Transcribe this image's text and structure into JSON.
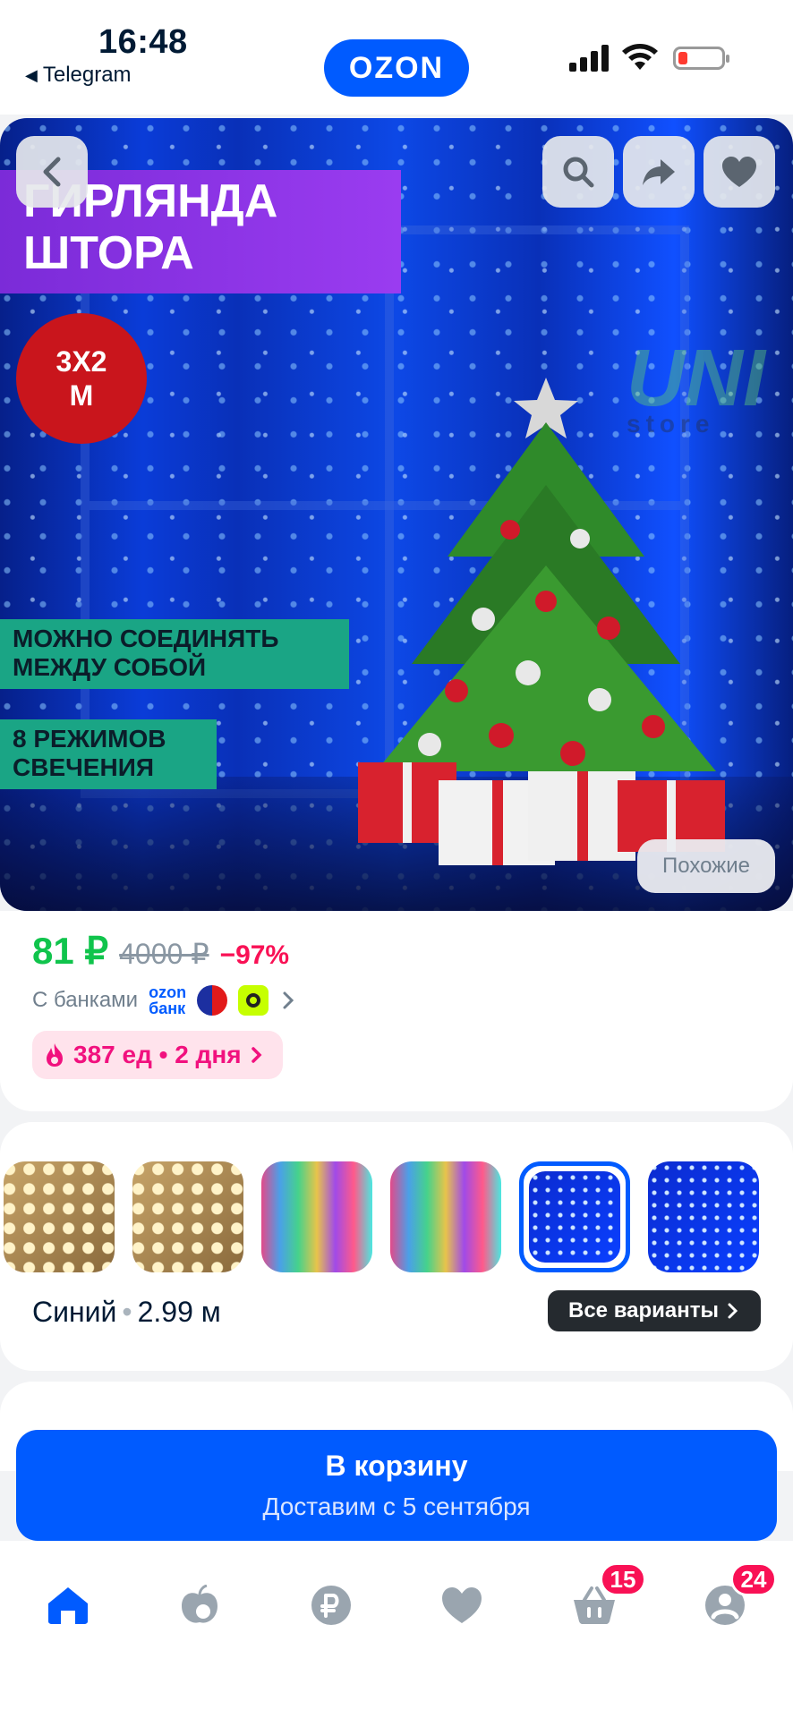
{
  "status_bar": {
    "time": "16:48",
    "back_app": "Telegram"
  },
  "header": {
    "logo": "OZON"
  },
  "hero": {
    "title_line1": "ГИРЛЯНДА",
    "title_line2": "ШТОРА",
    "size_line1": "3X2",
    "size_line2": "М",
    "feature1_line1": "МОЖНО СОЕДИНЯТЬ",
    "feature1_line2": "МЕЖДУ СОБОЙ",
    "feature2_line1": "8 РЕЖИМОВ",
    "feature2_line2": "СВЕЧЕНИЯ",
    "watermark": "UNI",
    "watermark_sub": "store",
    "similar_label": "Похожие"
  },
  "price": {
    "current": "81 ₽",
    "old": "4000 ₽",
    "discount": "−97%",
    "banks_label": "С банками",
    "ozon_bank_line1": "ozon",
    "ozon_bank_line2": "банк",
    "sale_info": "387 ед • 2 дня"
  },
  "variants": {
    "selected_label": "Синий",
    "selected_size": "2.99 м",
    "all_variants_label": "Все варианты",
    "selected_index": 4
  },
  "cart": {
    "button_label": "В корзину",
    "delivery_text": "Доставим с 5 сентября"
  },
  "tabbar": {
    "cart_badge": "15",
    "profile_badge": "24"
  },
  "colors": {
    "brand": "#005bff",
    "price_green": "#10c44c",
    "discount_pink": "#f91155"
  }
}
